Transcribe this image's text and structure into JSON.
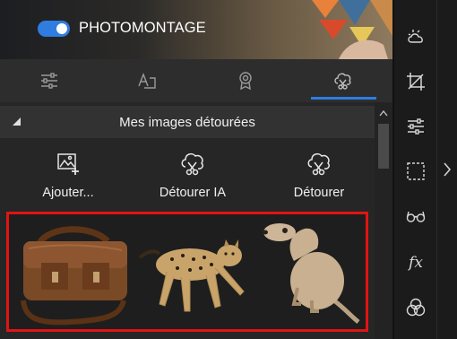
{
  "header": {
    "toggle_on": true,
    "title": "PHOTOMONTAGE"
  },
  "tabs": [
    {
      "icon": "sliders-icon",
      "active": false
    },
    {
      "icon": "text-frame-icon",
      "active": false
    },
    {
      "icon": "award-badge-icon",
      "active": false
    },
    {
      "icon": "cutout-icon",
      "active": true
    }
  ],
  "section": {
    "title": "Mes images détourées"
  },
  "actions": [
    {
      "icon": "add-image-icon",
      "label": "Ajouter..."
    },
    {
      "icon": "ai-cutout-icon",
      "label": "Détourer IA"
    },
    {
      "icon": "cutout-icon",
      "label": "Détourer"
    }
  ],
  "gallery": {
    "items": [
      {
        "name": "leather-bag-thumbnail"
      },
      {
        "name": "cheetah-thumbnail"
      },
      {
        "name": "meerkat-thumbnail"
      }
    ],
    "highlight_color": "#e01414"
  },
  "toolbar": [
    {
      "icon": "weather-icon"
    },
    {
      "icon": "crop-icon"
    },
    {
      "icon": "adjustments-icon"
    },
    {
      "icon": "selection-icon"
    },
    {
      "icon": "glasses-icon"
    },
    {
      "icon": "fx-icon",
      "text": "fx"
    },
    {
      "icon": "color-circles-icon"
    }
  ],
  "colors": {
    "accent": "#2f7de1",
    "panel": "#262626",
    "header": "#323232"
  }
}
